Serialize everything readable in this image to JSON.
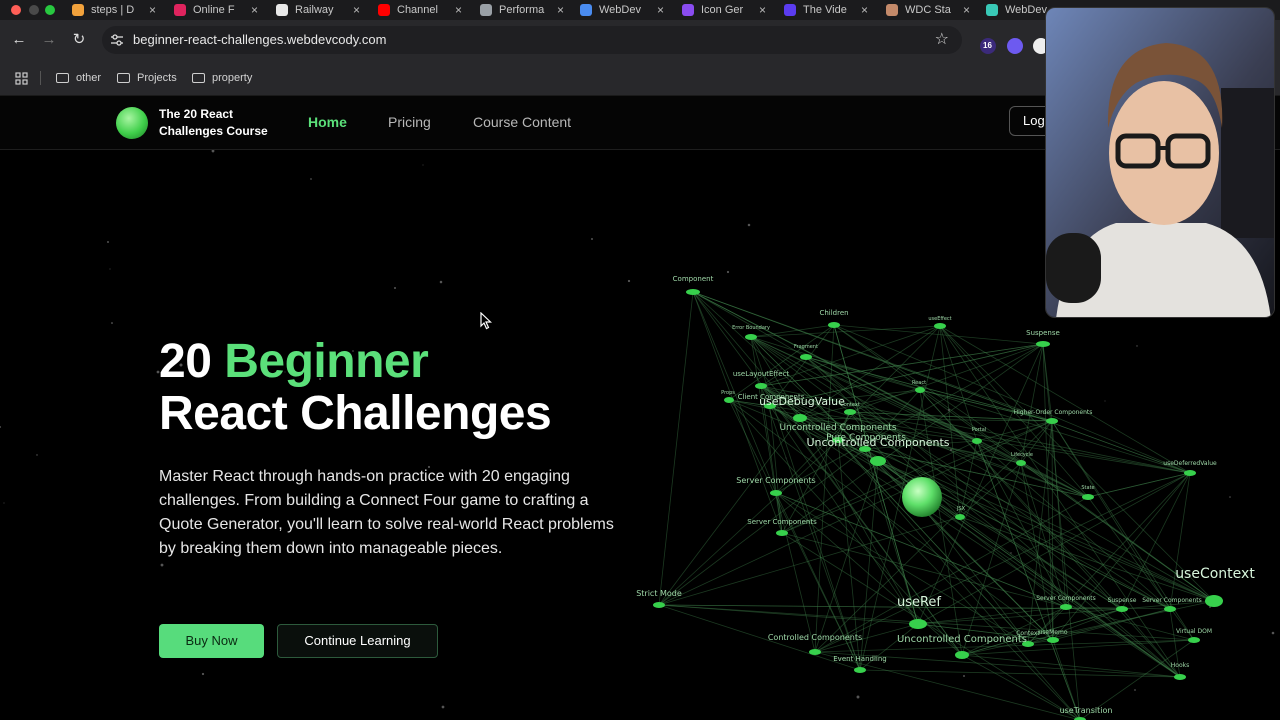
{
  "browser": {
    "tabs": [
      {
        "title": "steps | D",
        "favicon_color": "#f2a23c"
      },
      {
        "title": "Online F",
        "favicon_color": "#e0245e"
      },
      {
        "title": "Railway",
        "favicon_color": "#e8e8e8"
      },
      {
        "title": "Channel",
        "favicon_color": "#ff0000"
      },
      {
        "title": "Performa",
        "favicon_color": "#9aa0a6"
      },
      {
        "title": "WebDev",
        "favicon_color": "#4a8cf0"
      },
      {
        "title": "Icon Ger",
        "favicon_color": "#8a4cf0"
      },
      {
        "title": "The Vide",
        "favicon_color": "#5b3cf0"
      },
      {
        "title": "WDC Sta",
        "favicon_color": "#c48a6a"
      },
      {
        "title": "WebDev",
        "favicon_color": "#39c9b7"
      }
    ],
    "url": "beginner-react-challenges.webdevcody.com",
    "extension_badge": "16",
    "bookmarks": [
      "other",
      "Projects",
      "property"
    ]
  },
  "site": {
    "brand_line1": "The 20 React",
    "brand_line2": "Challenges Course",
    "nav": [
      {
        "label": "Home",
        "active": true
      },
      {
        "label": "Pricing",
        "active": false
      },
      {
        "label": "Course Content",
        "active": false
      }
    ],
    "login_label": "Logi",
    "accent_color": "#5be07a"
  },
  "hero": {
    "title_number": "20",
    "title_accent": "Beginner",
    "title_rest": "React Challenges",
    "description": "Master React through hands-on practice with 20 engaging challenges. From building a Connect Four game to crafting a Quote Generator, you'll learn to solve real-world React problems by breaking them down into manageable pieces.",
    "buy_label": "Buy Now",
    "continue_label": "Continue Learning"
  },
  "graph_labels": [
    "Component",
    "Error Boundary",
    "Children",
    "useEffect",
    "Fragment",
    "Suspense",
    "useLayoutEffect",
    "Props",
    "Client Components",
    "useDebugValue",
    "Context",
    "React",
    "Uncontrolled Components",
    "Pure Components",
    "Uncontrolled Components",
    "Portal",
    "Higher-Order Components",
    "Lifecycle",
    "useDeferredValue",
    "Server Components",
    "State",
    "Server Components",
    "JSX",
    "Strict Mode",
    "useRef",
    "useContext",
    "Server Components",
    "Suspense",
    "Server Components",
    "Virtual DOM",
    "Controlled Components",
    "Context",
    "useMemo",
    "Uncontrolled Components",
    "Event Handling",
    "Hooks",
    "useTransition"
  ]
}
